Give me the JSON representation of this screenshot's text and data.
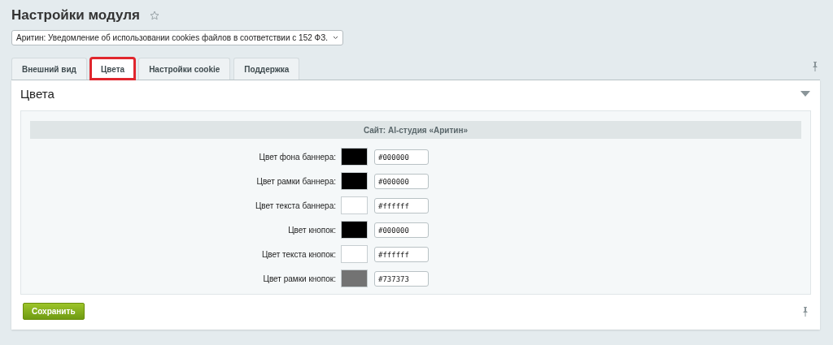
{
  "page_title": "Настройки модуля",
  "module_select": {
    "value": "Аритин: Уведомление об использовании cookies файлов в соответствии с 152 ФЗ."
  },
  "tabs": [
    {
      "label": "Внешний вид",
      "selected": false
    },
    {
      "label": "Цвета",
      "selected": true
    },
    {
      "label": "Настройки cookie",
      "selected": false
    },
    {
      "label": "Поддержка",
      "selected": false
    }
  ],
  "section": {
    "title": "Цвета",
    "expanded": true,
    "site_heading": "Сайт: AI-студия «Аритин»",
    "rows": [
      {
        "label": "Цвет фона баннера:",
        "color": "#000000",
        "value": "#000000"
      },
      {
        "label": "Цвет рамки баннера:",
        "color": "#000000",
        "value": "#000000"
      },
      {
        "label": "Цвет текста баннера:",
        "color": "#ffffff",
        "value": "#ffffff"
      },
      {
        "label": "Цвет кнопок:",
        "color": "#000000",
        "value": "#000000"
      },
      {
        "label": "Цвет текста кнопок:",
        "color": "#ffffff",
        "value": "#ffffff"
      },
      {
        "label": "Цвет рамки кнопок:",
        "color": "#737373",
        "value": "#737373"
      }
    ]
  },
  "save_button": "Сохранить"
}
